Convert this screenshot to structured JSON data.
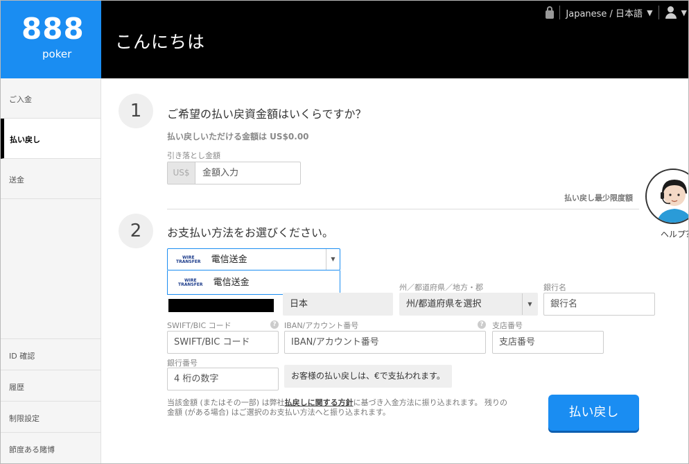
{
  "logo": {
    "big": "888",
    "small": "poker"
  },
  "header": {
    "greeting": "こんにちは",
    "language": "Japanese / 日本語"
  },
  "sidebar": {
    "items": [
      {
        "label": "ご入金"
      },
      {
        "label": "払い戻し"
      },
      {
        "label": "送金"
      }
    ],
    "bottom": [
      {
        "label": "ID 確認"
      },
      {
        "label": "履歴"
      },
      {
        "label": "制限設定"
      },
      {
        "label": "節度ある賭博"
      }
    ]
  },
  "step1": {
    "number": "1",
    "title": "ご希望の払い戻資金額はいくらですか？",
    "available": "払い戻しいただける金額は US$0.00",
    "amount_label": "引き落とし金額",
    "currency_prefix": "US$",
    "amount_placeholder": "金額入力",
    "min_link": "払い戻し最少限度額"
  },
  "step2": {
    "number": "2",
    "title": "お支払い方法をお選びください。",
    "method_selected": "電信送金",
    "method_logo": "WIRE TRANSFER",
    "dropdown_option": "電信送金",
    "country_value": "日本",
    "state_label": "州／都道府県／地方・郡",
    "state_value": "州/都道府県を選択",
    "bank_name_label": "銀行名",
    "bank_name_placeholder": "銀行名",
    "swift_label": "SWIFT/BIC コード",
    "swift_placeholder": "SWIFT/BIC コード",
    "iban_label": "IBAN/アカウント番号",
    "iban_placeholder": "IBAN/アカウント番号",
    "branch_label": "支店番号",
    "branch_placeholder": "支店番号",
    "bank_no_label": "銀行番号",
    "bank_no_placeholder": "4 桁の数字",
    "currency_note": "お客様の払い戻しは、€で支払われます。",
    "disclaimer_pre": "当該金額 (またはその一部) は弊社",
    "disclaimer_link": "払戻しに関する方針",
    "disclaimer_post": "に基づき入金方法に振り込まれます。 残りの",
    "disclaimer_line2": "金額 (がある場合) はご選択のお支払い方法へと振り込まれます。",
    "submit": "払い戻し",
    "help_label": "ヘルプ？"
  }
}
